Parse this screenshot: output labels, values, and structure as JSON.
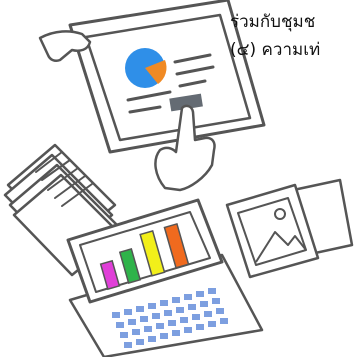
{
  "text": {
    "line1": "ร่วมกับชุมช",
    "line2": "(๔) ความเท่"
  },
  "colors": {
    "outline": "#555555",
    "screen_fill": "#ffffff",
    "pie": "#2f8fe8",
    "pie_slice": "#f08a24",
    "tablet_button": "#646b73",
    "bar_magenta": "#e03fd8",
    "bar_green": "#2fb34a",
    "bar_yellow": "#f2ef1a",
    "bar_orange": "#f06a1e",
    "key_blue": "#7d9fe0"
  },
  "illustration": {
    "items": [
      "tablet",
      "pointing-hand",
      "pie-chart",
      "document-stack",
      "photo-prints",
      "laptop",
      "bar-chart"
    ]
  }
}
